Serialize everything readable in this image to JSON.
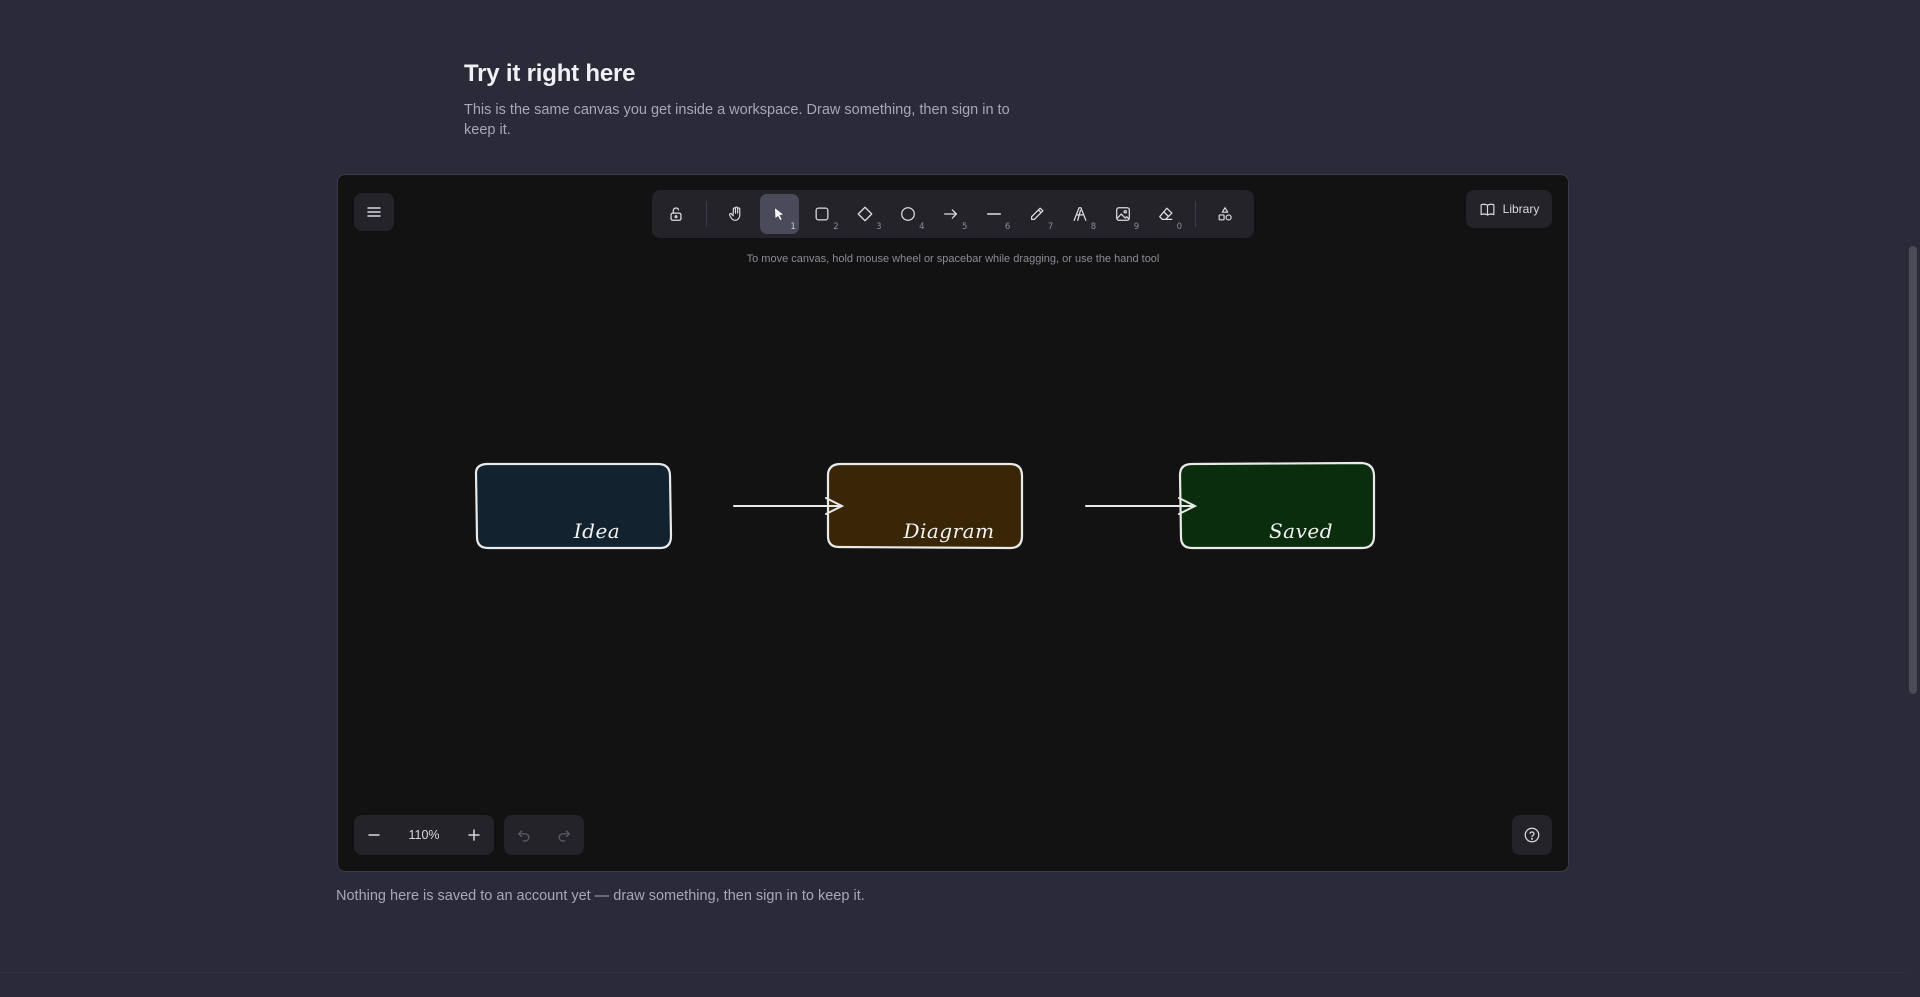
{
  "intro": {
    "title": "Try it right here",
    "description": "This is the same canvas you get inside a workspace. Draw something, then sign in to keep it."
  },
  "toolbar": {
    "tools": [
      {
        "name": "lock-icon",
        "key": ""
      },
      {
        "name": "hand-icon",
        "key": ""
      },
      {
        "name": "selection-icon",
        "key": "1",
        "active": true
      },
      {
        "name": "rectangle-icon",
        "key": "2"
      },
      {
        "name": "diamond-icon",
        "key": "3"
      },
      {
        "name": "ellipse-icon",
        "key": "4"
      },
      {
        "name": "arrow-icon",
        "key": "5"
      },
      {
        "name": "line-icon",
        "key": "6"
      },
      {
        "name": "pencil-icon",
        "key": "7"
      },
      {
        "name": "text-icon",
        "key": "8"
      },
      {
        "name": "image-icon",
        "key": "9"
      },
      {
        "name": "eraser-icon",
        "key": "0"
      },
      {
        "name": "shapes-icon",
        "key": ""
      }
    ]
  },
  "canvas": {
    "hint": "To move canvas, hold mouse wheel or spacebar while dragging, or use the hand tool",
    "library_label": "Library",
    "zoom": "110%",
    "nodes": [
      {
        "label": "Idea",
        "fill": "#12222e"
      },
      {
        "label": "Diagram",
        "fill": "#382606"
      },
      {
        "label": "Saved",
        "fill": "#0a2d0e"
      }
    ]
  },
  "footnote": "Nothing here is saved to an account yet — draw something, then sign in to keep it.",
  "colors": {
    "page_bg": "#2a2a38",
    "canvas_bg": "#121212",
    "active_tool": "#4a4a5a"
  }
}
